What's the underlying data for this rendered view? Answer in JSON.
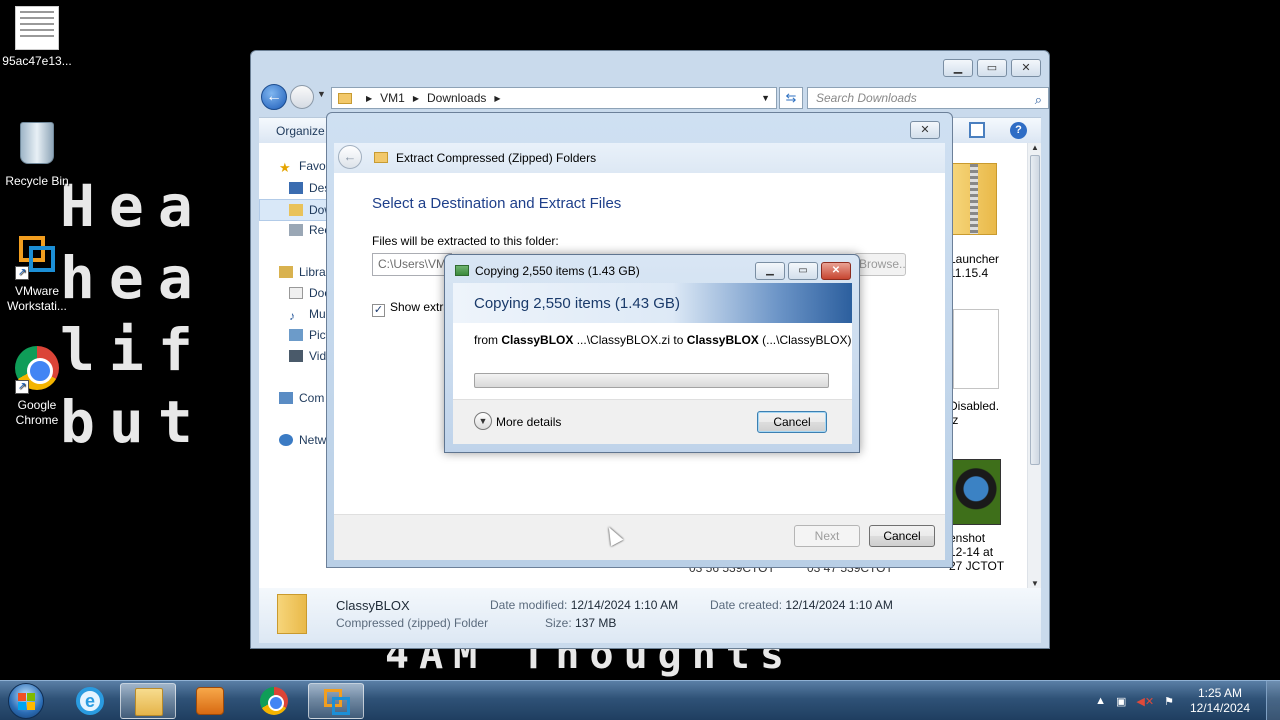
{
  "wallpaper": {
    "lines": [
      "Hea      p,",
      "hea       up,",
      "lif       p,",
      "but         ng."
    ],
    "bottom_text": "4AM Thoughts"
  },
  "desktop": {
    "icons": [
      {
        "label": "95ac47e13...",
        "icon": "text-file-thumbnail"
      },
      {
        "label": "Recycle Bin",
        "icon": "recycle-bin"
      },
      {
        "label": "VMware Workstati...",
        "icon": "vmware-workstation"
      },
      {
        "label": "Google Chrome",
        "icon": "google-chrome"
      }
    ]
  },
  "explorer": {
    "window_controls": [
      "minimize",
      "maximize",
      "close"
    ],
    "breadcrumb": [
      "VM1",
      "Downloads"
    ],
    "search_placeholder": "Search Downloads",
    "command_bar": {
      "organize": "Organize"
    },
    "nav_pane": [
      {
        "label": "Favo",
        "icon": "star-icon"
      },
      {
        "label": "Des",
        "icon": "desktop-icon"
      },
      {
        "label": "Dow",
        "icon": "downloads-folder-icon"
      },
      {
        "label": "Rec",
        "icon": "recent-places-icon"
      },
      {
        "label": "Libra",
        "icon": "libraries-icon"
      },
      {
        "label": "Doc",
        "icon": "documents-icon"
      },
      {
        "label": "Mu",
        "icon": "music-icon"
      },
      {
        "label": "Pict",
        "icon": "pictures-icon"
      },
      {
        "label": "Vid",
        "icon": "videos-icon"
      },
      {
        "label": "Com",
        "icon": "computer-icon"
      },
      {
        "label": "Netw",
        "icon": "network-icon"
      }
    ],
    "files": [
      {
        "line1": "Launcher",
        "line2": "11.15.4"
      },
      {
        "line1": "Disabled.",
        "line2": "fz"
      },
      {
        "line1": "enshot",
        "line2": "12-14 at",
        "line3": "27 JCTOT"
      }
    ],
    "file_fragments": [
      "03 56 539CTOT",
      "03 47 539CTOT"
    ],
    "details": {
      "name": "ClassyBLOX",
      "type": "Compressed (zipped) Folder",
      "date_modified_label": "Date modified:",
      "date_modified": "12/14/2024 1:10 AM",
      "date_created_label": "Date created:",
      "date_created": "12/14/2024 1:10 AM",
      "size_label": "Size:",
      "size": "137 MB"
    }
  },
  "wizard": {
    "title": "Extract Compressed (Zipped) Folders",
    "heading": "Select a Destination and Extract Files",
    "label": "Files will be extracted to this folder:",
    "path_value": "C:\\Users\\VM",
    "browse_label": "Browse...",
    "checkbox_label": "Show extra",
    "checkbox_checked": true,
    "next_label": "Next",
    "cancel_label": "Cancel"
  },
  "copy_dialog": {
    "title": "Copying 2,550 items (1.43 GB)",
    "banner": "Copying 2,550 items (1.43 GB)",
    "from_prefix": "from ",
    "from_name": "ClassyBLOX",
    "from_path": " ...\\ClassyBLOX.zi to ",
    "to_name": "ClassyBLOX",
    "to_path": " (...\\ClassyBLOX)",
    "progress_fraction": 0.0,
    "more_details_label": "More details",
    "cancel_label": "Cancel"
  },
  "taskbar": {
    "pinned": [
      {
        "name": "internet-explorer",
        "active": false
      },
      {
        "name": "windows-explorer",
        "active": true
      },
      {
        "name": "windows-media-player",
        "active": false
      },
      {
        "name": "google-chrome",
        "active": false
      },
      {
        "name": "vmware-workstation",
        "active": true
      }
    ],
    "clock_time": "1:25 AM",
    "clock_date": "12/14/2024"
  },
  "colors": {
    "accent": "#1e3f8a",
    "taskbar": "#2f5277",
    "progress": "#3fae3b"
  }
}
